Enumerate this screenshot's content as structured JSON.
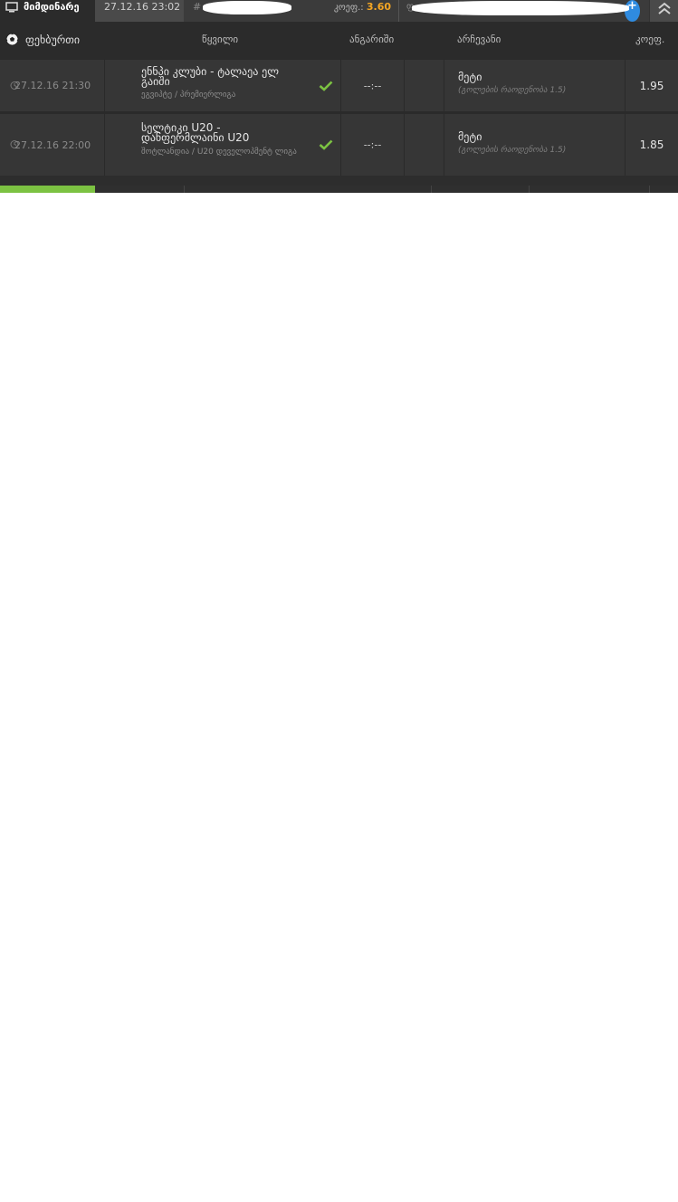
{
  "topbar": {
    "status": "მიმდინარე",
    "date": "27.12.16 23:02",
    "id_prefix": "#",
    "odds_label": "კოეფ.:",
    "odds_value": "3.60",
    "prize_prefix": "ფ"
  },
  "header": {
    "sport": "ფეხბურთი",
    "event": "წყვილი",
    "score": "ანგარიში",
    "pick": "არჩევანი",
    "coef": "კოეფ."
  },
  "rows": [
    {
      "datetime": "27.12.16 21:30",
      "teams": "ენნპი კლუბი - ტალაეა ელ გაიში",
      "league": "ეგვიპტე / პრემიერლიგა",
      "score": "--:--",
      "pick": "მეტი",
      "pick_detail": "(გოლების რაოდენობა 1.5)",
      "coef": "1.95"
    },
    {
      "datetime": "27.12.16 22:00",
      "teams": "სელტიკი U20 - დანფერმლაინი U20",
      "league": "შოტლანდია / U20 დეველოპმენტ ლიგა",
      "score": "--:--",
      "pick": "მეტი",
      "pick_detail": "(გოლების რაოდენობა 1.5)",
      "coef": "1.85"
    }
  ],
  "colors": {
    "accent_odds": "#f5a623",
    "check": "#7cc242",
    "progress": "#7cc242",
    "plus_button": "#2f8be0"
  },
  "progress_fraction": 0.14
}
